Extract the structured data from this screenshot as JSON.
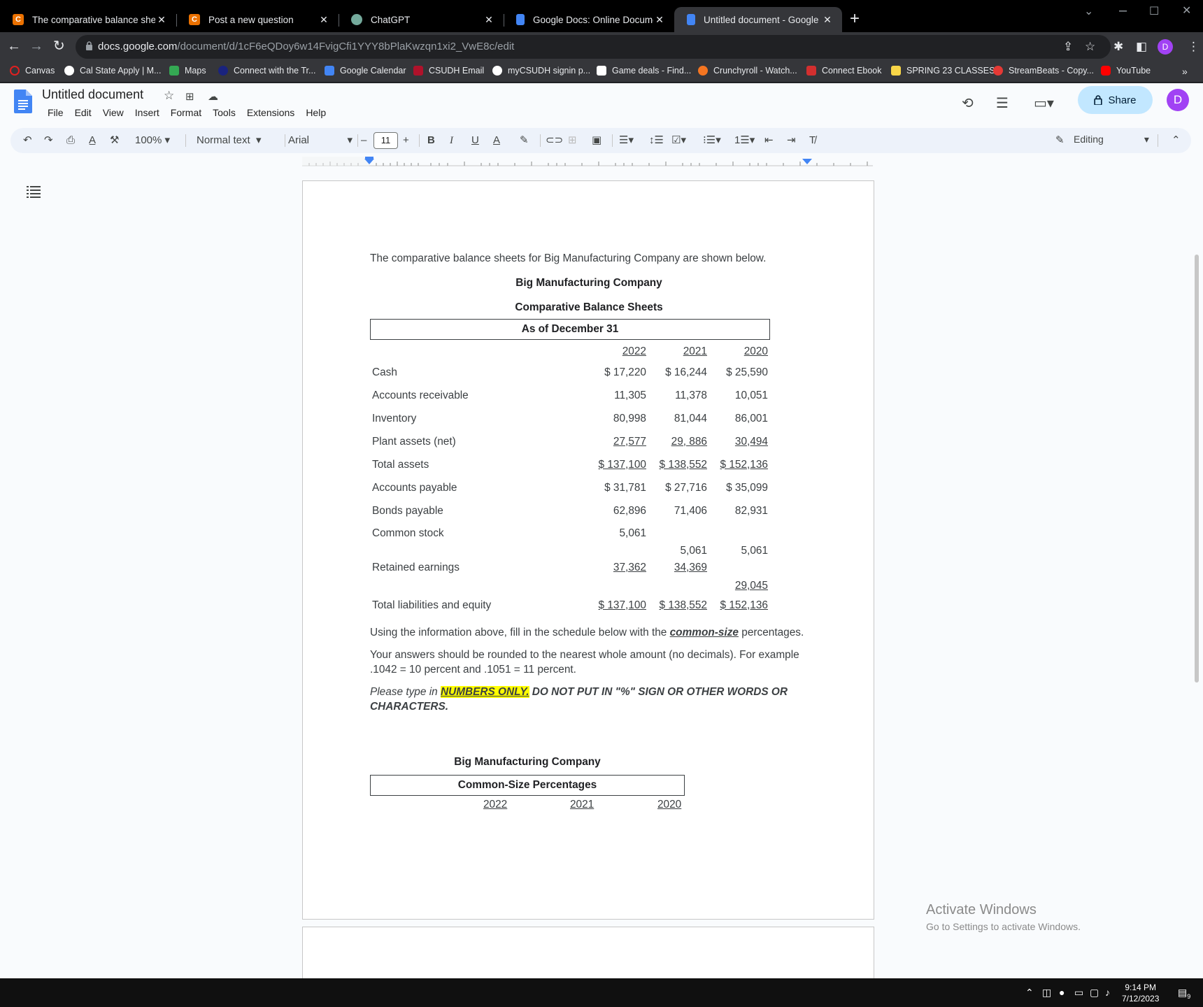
{
  "browser": {
    "tabs": [
      {
        "title": "The comparative balance sheets",
        "icon": "chegg-icon",
        "color": "#eb7100",
        "letter": "C"
      },
      {
        "title": "Post a new question",
        "icon": "chegg-icon",
        "color": "#eb7100",
        "letter": "C"
      },
      {
        "title": "ChatGPT",
        "icon": "chatgpt-icon",
        "color": "#74aa9c",
        "letter": ""
      },
      {
        "title": "Google Docs: Online Document E",
        "icon": "docs-icon",
        "color": "#4285f4",
        "letter": ""
      },
      {
        "title": "Untitled document - Google Doc",
        "icon": "docs-icon",
        "color": "#4285f4",
        "letter": ""
      }
    ],
    "url_host": "docs.google.com",
    "url_path": "/document/d/1cF6eQDoy6w14FvigCfi1YYY8bPlaKwzqn1xi2_VwE8c/edit",
    "profile_initial": "D",
    "bookmarks": [
      {
        "label": "Canvas",
        "color": "#e02020"
      },
      {
        "label": "Cal State Apply | M...",
        "color": "#ffffff"
      },
      {
        "label": "Maps",
        "color": "#34a853"
      },
      {
        "label": "Connect with the Tr...",
        "color": "#1a237e"
      },
      {
        "label": "Google Calendar",
        "color": "#4285f4"
      },
      {
        "label": "CSUDH Email",
        "color": "#b0122b"
      },
      {
        "label": "myCSUDH signin p...",
        "color": "#ffffff"
      },
      {
        "label": "Game deals - Find...",
        "color": "#ffffff"
      },
      {
        "label": "Crunchyroll - Watch...",
        "color": "#f47521"
      },
      {
        "label": "Connect Ebook",
        "color": "#d32f2f"
      },
      {
        "label": "SPRING 23 CLASSES",
        "color": "#f9d648"
      },
      {
        "label": "StreamBeats - Copy...",
        "color": "#e53935"
      },
      {
        "label": "YouTube",
        "color": "#ff0000"
      }
    ]
  },
  "docs": {
    "title": "Untitled document",
    "menu": [
      "File",
      "Edit",
      "View",
      "Insert",
      "Format",
      "Tools",
      "Extensions",
      "Help"
    ],
    "share_label": "Share",
    "avatar_initial": "D",
    "zoom": "100%",
    "style": "Normal text",
    "font": "Arial",
    "font_size": "11",
    "mode": "Editing"
  },
  "document": {
    "intro": "The comparative balance sheets for Big Manufacturing Company are shown below.",
    "company": "Big Manufacturing Company",
    "sheet_title": "Comparative Balance Sheets",
    "as_of": "As of December 31",
    "years": [
      "2022",
      "2021",
      "2020"
    ],
    "rows": [
      {
        "label": "Cash",
        "values": [
          "$ 17,220",
          "$ 16,244",
          "$ 25,590"
        ]
      },
      {
        "label": "Accounts receivable",
        "values": [
          "11,305",
          "11,378",
          "10,051"
        ]
      },
      {
        "label": "Inventory",
        "values": [
          "80,998",
          "81,044",
          "86,001"
        ]
      },
      {
        "label": "Plant assets (net)",
        "values": [
          "27,577",
          "29, 886",
          "30,494"
        ]
      },
      {
        "label": "Total assets",
        "values": [
          "$ 137,100",
          "$ 138,552",
          "$ 152,136"
        ]
      },
      {
        "label": "Accounts payable",
        "values": [
          "$ 31,781",
          "$ 27,716",
          "$ 35,099"
        ]
      },
      {
        "label": "Bonds payable",
        "values": [
          "62,896",
          "71,406",
          "82,931"
        ]
      },
      {
        "label": "Common stock",
        "values": [
          "5,061",
          "5,061",
          "5,061"
        ]
      },
      {
        "label": "Retained earnings",
        "values": [
          "37,362",
          "34,369",
          "29,045"
        ]
      },
      {
        "label": "Total liabilities and equity",
        "values": [
          "$ 137,100",
          "$ 138,552",
          "$ 152,136"
        ]
      }
    ],
    "instruction_1a": "Using the information above, fill in the schedule below with the ",
    "instruction_1b": "common-size",
    "instruction_1c": " percentages.",
    "instruction_2": "Your answers should be rounded to the nearest whole amount (no decimals).  For example .1042 = 10 percent and .1051 = 11 percent.",
    "instruction_3a": "Please type in ",
    "instruction_3b": "NUMBERS ONLY.",
    "instruction_3c": "  DO NOT PUT IN \"%\" SIGN OR OTHER WORDS OR CHARACTERS.",
    "company_2": "Big Manufacturing Company",
    "schedule_title": "Common-Size Percentages",
    "years_2": [
      "2022",
      "2021",
      "2020"
    ]
  },
  "watermark": {
    "line1": "Activate Windows",
    "line2": "Go to Settings to activate Windows."
  },
  "taskbar": {
    "time": "9:14 PM",
    "date": "7/12/2023",
    "notif_count": "9"
  }
}
